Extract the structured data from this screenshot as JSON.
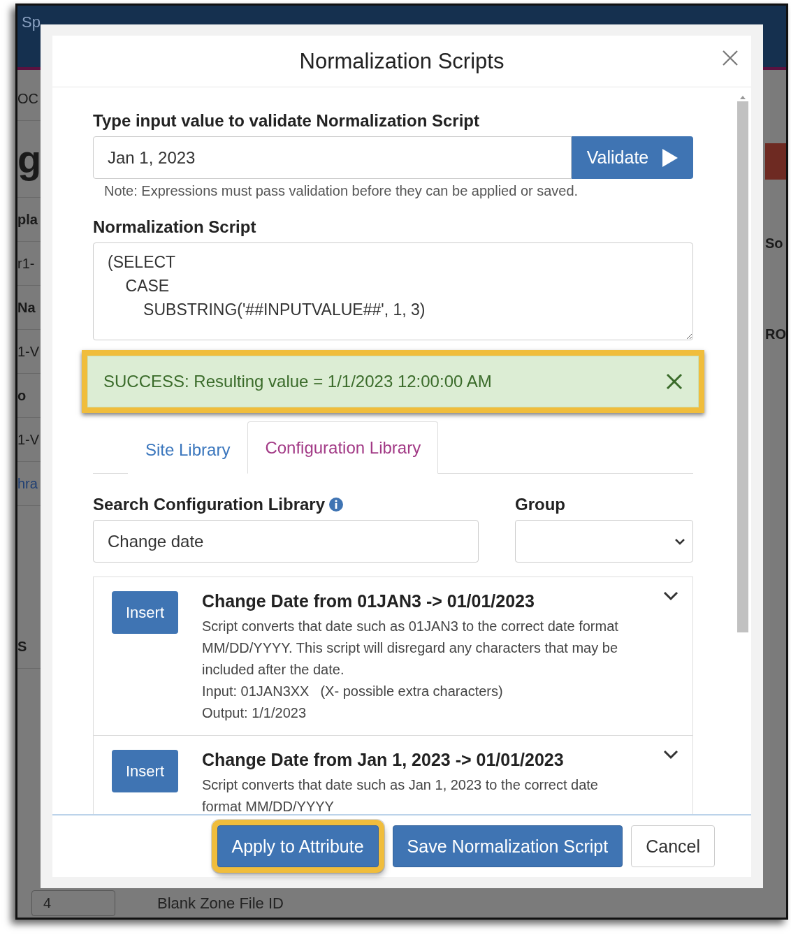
{
  "background": {
    "header_text": "Sp",
    "left_fragments": [
      {
        "text": "OC",
        "kind": "plain"
      },
      {
        "text": "g",
        "kind": "heading"
      },
      {
        "text": "pla",
        "kind": "label"
      },
      {
        "text": "r1-",
        "kind": "plain"
      },
      {
        "text": "Na",
        "kind": "label"
      },
      {
        "text": "1-V",
        "kind": "plain"
      },
      {
        "text": "o",
        "kind": "label"
      },
      {
        "text": "1-V",
        "kind": "plain"
      },
      {
        "text": "hra",
        "kind": "link"
      },
      {
        "text": "S",
        "kind": "label"
      }
    ],
    "right_fragments": [
      "So",
      "RO"
    ],
    "footer_fragments": [
      "4",
      "Blank Zone File ID"
    ]
  },
  "modal": {
    "title": "Normalization Scripts",
    "validate": {
      "label": "Type input value to validate Normalization Script",
      "value": "Jan 1, 2023",
      "button": "Validate",
      "note": "Note: Expressions must pass validation before they can be applied or saved."
    },
    "script": {
      "label": "Normalization Script",
      "value": "(SELECT\n    CASE\n        SUBSTRING('##INPUTVALUE##', 1, 3)"
    },
    "alert": {
      "text": "SUCCESS: Resulting value = 1/1/2023 12:00:00 AM",
      "highlighted": true
    },
    "tabs": [
      {
        "label": "Site Library",
        "selected": false
      },
      {
        "label": "Configuration Library",
        "selected": true
      }
    ],
    "search": {
      "label": "Search Configuration Library",
      "value": "Change date"
    },
    "group": {
      "label": "Group"
    },
    "results": [
      {
        "button": "Insert",
        "title": "Change Date from 01JAN3 -> 01/01/2023",
        "description": "Script converts that date such as 01JAN3 to the correct date format MM/DD/YYYY. This script will disregard any characters that may be included after the date.",
        "input": "Input: 01JAN3XX",
        "input_note": "(X- possible extra characters)",
        "output": "Output: 1/1/2023",
        "expanded": false
      },
      {
        "button": "Insert",
        "title": "Change Date from Jan 1, 2023 -> 01/01/2023",
        "description": "Script converts that date such as Jan 1, 2023 to the correct date format MM/DD/YYYY",
        "expanded": false
      }
    ],
    "footer_buttons": [
      {
        "label": "Apply to Attribute",
        "kind": "primary",
        "highlighted": true
      },
      {
        "label": "Save Normalization Script",
        "kind": "primary",
        "highlighted": false
      },
      {
        "label": "Cancel",
        "kind": "default",
        "highlighted": false
      }
    ]
  }
}
